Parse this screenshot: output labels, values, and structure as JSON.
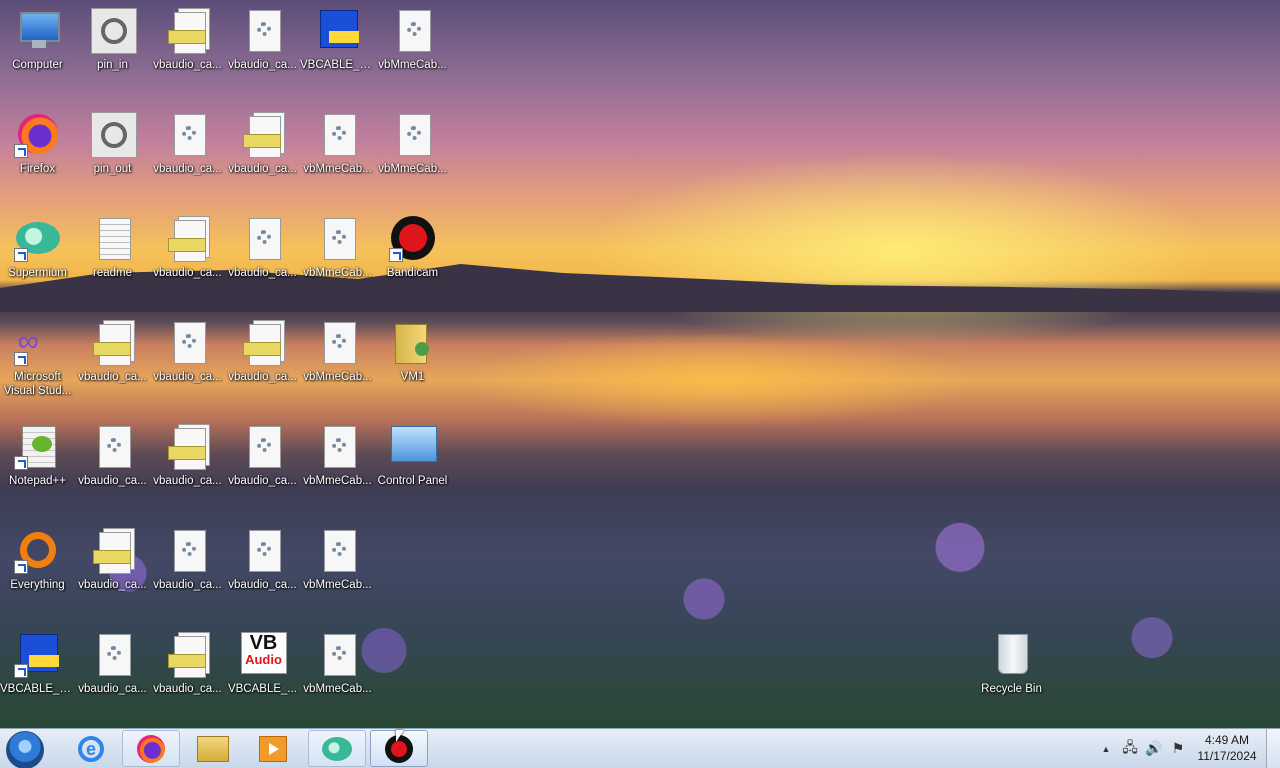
{
  "desktop": {
    "icons": [
      {
        "label": "Computer",
        "icon": "computer-icon"
      },
      {
        "label": "pin_in",
        "icon": "reel-icon"
      },
      {
        "label": "vbaudio_ca...",
        "icon": "setup-stack-icon"
      },
      {
        "label": "vbaudio_ca...",
        "icon": "gear-file-icon"
      },
      {
        "label": "VBCABLE_S...",
        "icon": "installer-icon"
      },
      {
        "label": "vbMmeCab...",
        "icon": "gear-file-icon"
      },
      {
        "label": "Firefox",
        "icon": "firefox-icon"
      },
      {
        "label": "pin_out",
        "icon": "reel-icon"
      },
      {
        "label": "vbaudio_ca...",
        "icon": "gear-file-icon"
      },
      {
        "label": "vbaudio_ca...",
        "icon": "setup-stack-icon"
      },
      {
        "label": "vbMmeCab...",
        "icon": "gear-file-icon"
      },
      {
        "label": "vbMmeCab...",
        "icon": "gear-file-icon"
      },
      {
        "label": "Supermium",
        "icon": "supermium-icon"
      },
      {
        "label": "readme",
        "icon": "text-file-icon"
      },
      {
        "label": "vbaudio_ca...",
        "icon": "setup-stack-icon"
      },
      {
        "label": "vbaudio_ca...",
        "icon": "gear-file-icon"
      },
      {
        "label": "vbMmeCab...",
        "icon": "gear-file-icon"
      },
      {
        "label": "Bandicam",
        "icon": "bandicam-icon"
      },
      {
        "label": "Microsoft Visual Stud...",
        "icon": "visual-studio-icon"
      },
      {
        "label": "vbaudio_ca...",
        "icon": "setup-stack-icon"
      },
      {
        "label": "vbaudio_ca...",
        "icon": "gear-file-icon"
      },
      {
        "label": "vbaudio_ca...",
        "icon": "setup-stack-icon"
      },
      {
        "label": "vbMmeCab...",
        "icon": "gear-file-icon"
      },
      {
        "label": "VM1",
        "icon": "user-folder-icon"
      },
      {
        "label": "Notepad++",
        "icon": "notepad-plus-plus-icon"
      },
      {
        "label": "vbaudio_ca...",
        "icon": "gear-file-icon"
      },
      {
        "label": "vbaudio_ca...",
        "icon": "setup-stack-icon"
      },
      {
        "label": "vbaudio_ca...",
        "icon": "gear-file-icon"
      },
      {
        "label": "vbMmeCab...",
        "icon": "gear-file-icon"
      },
      {
        "label": "Control Panel",
        "icon": "control-panel-icon"
      },
      {
        "label": "Everything",
        "icon": "everything-icon"
      },
      {
        "label": "vbaudio_ca...",
        "icon": "setup-stack-icon"
      },
      {
        "label": "vbaudio_ca...",
        "icon": "gear-file-icon"
      },
      {
        "label": "vbaudio_ca...",
        "icon": "gear-file-icon"
      },
      {
        "label": "vbMmeCab...",
        "icon": "gear-file-icon"
      },
      {
        "label": "VBCABLE_S...",
        "icon": "installer-icon"
      },
      {
        "label": "vbaudio_ca...",
        "icon": "gear-file-icon"
      },
      {
        "label": "vbaudio_ca...",
        "icon": "setup-stack-icon"
      },
      {
        "label": "VBCABLE_...",
        "icon": "vbaudio-logo-icon"
      },
      {
        "label": "vbMmeCab...",
        "icon": "gear-file-icon"
      },
      {
        "label": "Recycle Bin",
        "icon": "recycle-bin-icon"
      }
    ],
    "vbaudio_logo": {
      "line1": "VB",
      "line2": "Audio"
    }
  },
  "taskbar": {
    "ie_glyph": "e",
    "tray": {
      "chevron": "▲",
      "network": "🖧",
      "volume": "🔊",
      "flag": "⚑"
    },
    "clock": {
      "time": "4:49 AM",
      "date": "11/17/2024"
    }
  }
}
